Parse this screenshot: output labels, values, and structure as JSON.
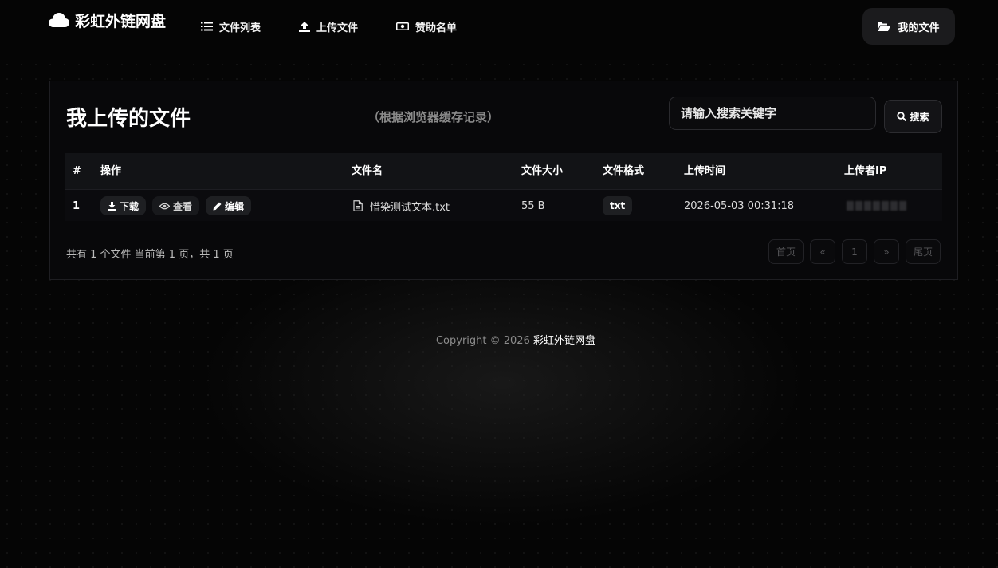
{
  "brand": {
    "name": "彩虹外链网盘",
    "icon": "cloud-icon"
  },
  "nav": {
    "items": [
      {
        "label": "文件列表",
        "icon": "list-icon"
      },
      {
        "label": "上传文件",
        "icon": "upload-icon"
      },
      {
        "label": "赞助名单",
        "icon": "money-icon"
      }
    ],
    "my_files": {
      "label": "我的文件",
      "icon": "folder-open-icon"
    }
  },
  "panel": {
    "title": "我上传的文件",
    "subtitle": "（根据浏览器缓存记录）",
    "search": {
      "placeholder": "请输入搜索关键字",
      "button": "搜索",
      "icon": "search-icon"
    }
  },
  "table": {
    "headers": [
      "#",
      "操作",
      "文件名",
      "文件大小",
      "文件格式",
      "上传时间",
      "上传者IP"
    ],
    "rows": [
      {
        "index": "1",
        "actions": {
          "download": "下载",
          "view": "查看",
          "edit": "编辑"
        },
        "filename": "惜染测试文本.txt",
        "size": "55 B",
        "format": "txt",
        "time": "2026-05-03 00:31:18"
      }
    ]
  },
  "summary": {
    "text": "共有 1 个文件  当前第 1 页，共 1 页"
  },
  "pagination": {
    "first": "首页",
    "prev": "«",
    "current": "1",
    "next": "»",
    "last": "尾页"
  },
  "footer": {
    "prefix": "Copyright © 2026 ",
    "site": "彩虹外链网盘"
  },
  "colors": {
    "background": "#050505",
    "panel": "#08080a",
    "accent": "#ffffff",
    "muted": "#8a8a8a"
  }
}
